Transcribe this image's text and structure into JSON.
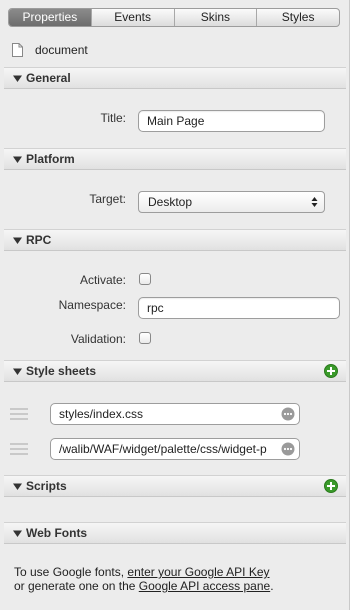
{
  "tabs": [
    {
      "label": "Properties",
      "active": true
    },
    {
      "label": "Events",
      "active": false
    },
    {
      "label": "Skins",
      "active": false
    },
    {
      "label": "Styles",
      "active": false
    }
  ],
  "document": {
    "label": "document",
    "icon": "document-icon"
  },
  "sections": {
    "general": "General",
    "platform": "Platform",
    "rpc": "RPC",
    "style_sheets": "Style sheets",
    "scripts": "Scripts",
    "web_fonts": "Web Fonts"
  },
  "general": {
    "title_label": "Title:",
    "title_value": "Main Page"
  },
  "platform": {
    "target_label": "Target:",
    "target_value": "Desktop"
  },
  "rpc": {
    "activate_label": "Activate:",
    "activate_checked": false,
    "namespace_label": "Namespace:",
    "namespace_value": "rpc",
    "validation_label": "Validation:",
    "validation_checked": false
  },
  "style_sheets": [
    "styles/index.css",
    "/walib/WAF/widget/palette/css/widget-p"
  ],
  "web_fonts": {
    "text1": "To use Google fonts, ",
    "link1": "enter your Google API Key",
    "text2": "or generate one on the ",
    "link2": "Google API access pane",
    "text3": "."
  },
  "colors": {
    "accent_green": "#3a9a2a",
    "active_tab": "#7a7a7a"
  }
}
